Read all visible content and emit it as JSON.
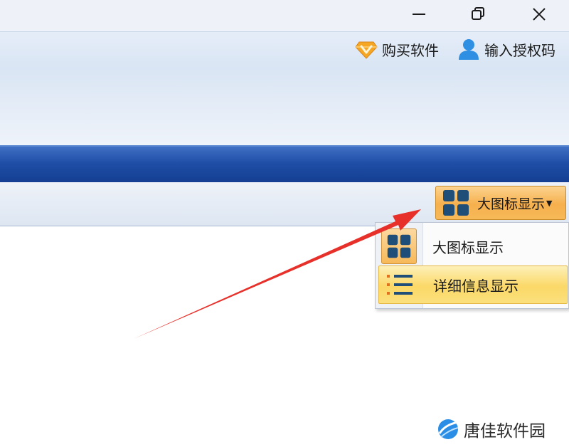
{
  "header_links": {
    "buy_label": "购买软件",
    "auth_label": "输入授权码"
  },
  "view_switch": {
    "current_label": "大图标显示",
    "options": [
      {
        "label": "大图标显示",
        "icon": "large-icons-grid-icon",
        "checked": true
      },
      {
        "label": "详细信息显示",
        "icon": "details-list-icon",
        "checked": false,
        "highlighted": true
      }
    ]
  },
  "watermark": {
    "text": "唐佳软件园"
  },
  "colors": {
    "ribbon_band": "#1f4ea7",
    "accent_orange": "#f6b04d",
    "highlight_yellow": "#fbd867",
    "arrow_red": "#e8302a"
  }
}
